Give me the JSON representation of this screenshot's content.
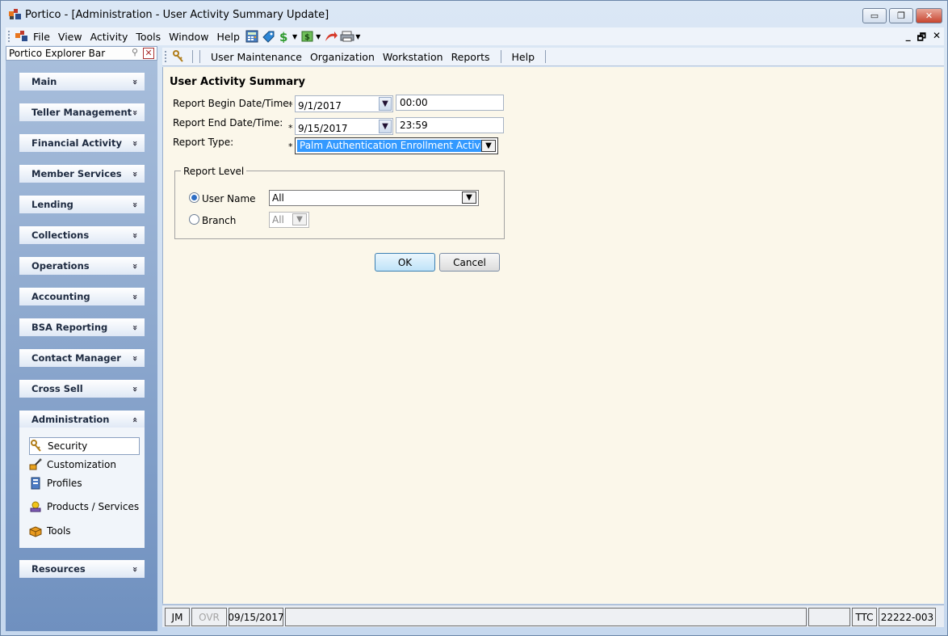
{
  "window": {
    "title": "Portico - [Administration - User Activity Summary Update]",
    "controls": {
      "minimize": "▭",
      "restore": "❐",
      "close": "✕"
    }
  },
  "menubar": {
    "items": [
      "File",
      "View",
      "Activity",
      "Tools",
      "Window",
      "Help"
    ],
    "mdi_controls": {
      "minimize": "_",
      "restore": "🗗",
      "close": "✕"
    }
  },
  "explorer": {
    "title": "Portico Explorer Bar",
    "groups": [
      {
        "label": "Main",
        "chevron": "»"
      },
      {
        "label": "Teller Management",
        "chevron": "»"
      },
      {
        "label": "Financial Activity",
        "chevron": "»"
      },
      {
        "label": "Member Services",
        "chevron": "»"
      },
      {
        "label": "Lending",
        "chevron": "»"
      },
      {
        "label": "Collections",
        "chevron": "»"
      },
      {
        "label": "Operations",
        "chevron": "»"
      },
      {
        "label": "Accounting",
        "chevron": "»"
      },
      {
        "label": "BSA Reporting",
        "chevron": "»"
      },
      {
        "label": "Contact Manager",
        "chevron": "»"
      },
      {
        "label": "Cross Sell",
        "chevron": "»"
      },
      {
        "label": "Administration",
        "chevron": "«"
      },
      {
        "label": "Resources",
        "chevron": "»"
      }
    ],
    "admin_items": [
      "Security",
      "Customization",
      "Profiles",
      "Products / Services",
      "Tools"
    ]
  },
  "subtoolbar": {
    "items": [
      "User Maintenance",
      "Organization",
      "Workstation",
      "Reports"
    ],
    "help": "Help"
  },
  "form": {
    "title": "User Activity Summary",
    "begin_label": "Report Begin Date/Time:",
    "begin_date": "9/1/2017",
    "begin_time": "00:00",
    "end_label": "Report End Date/Time:",
    "end_date": "9/15/2017",
    "end_time": "23:59",
    "type_label": "Report Type:",
    "type_value": "Palm Authentication Enrollment Activity",
    "required_mark": "*",
    "report_level": {
      "legend": "Report Level",
      "user_name_label": "User Name",
      "user_name_value": "All",
      "branch_label": "Branch",
      "branch_value": "All"
    },
    "ok": "OK",
    "cancel": "Cancel"
  },
  "statusbar": {
    "user": "JM",
    "ovr": "OVR",
    "date": "09/15/2017",
    "code": "TTC",
    "id": "22222-003"
  },
  "colors": {
    "content_bg": "#fbf7ea",
    "selection": "#3399ff",
    "explorer_gradient_top": "#a9bfdc",
    "explorer_gradient_bottom": "#6f90bf"
  }
}
